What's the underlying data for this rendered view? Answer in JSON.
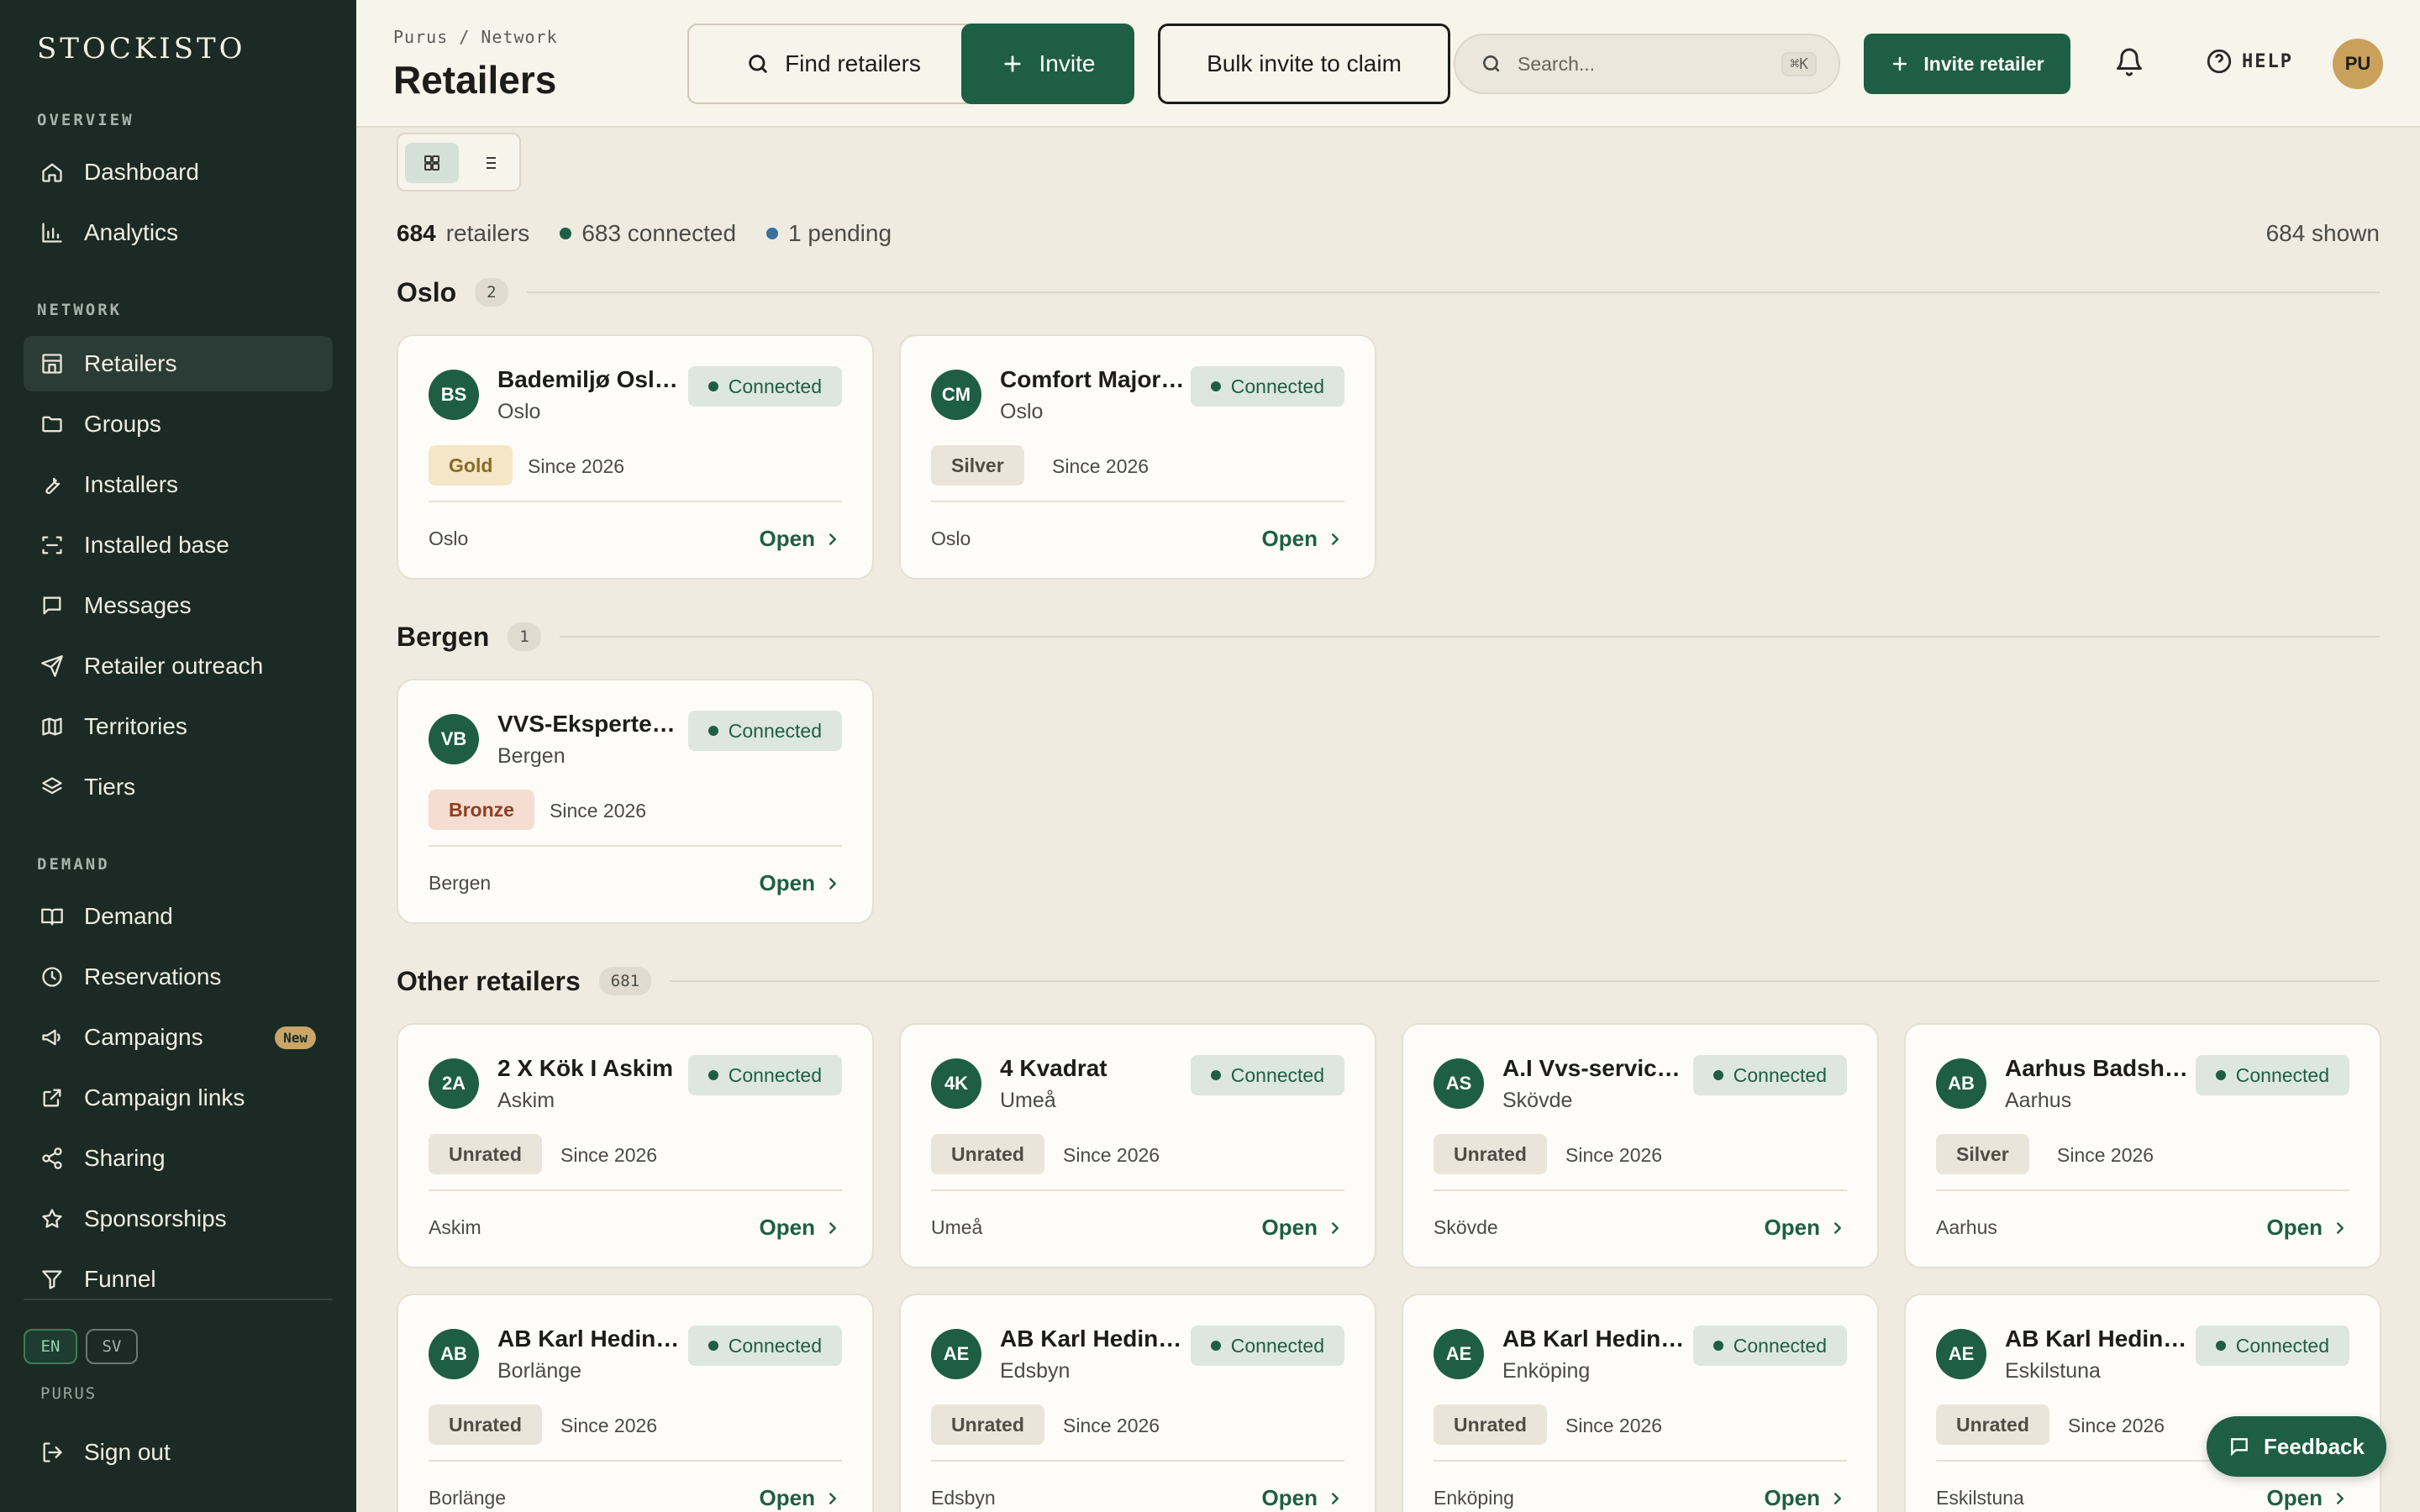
{
  "app": {
    "logo": "STOCKISTO"
  },
  "sidebar": {
    "sections": [
      {
        "label": "OVERVIEW"
      },
      {
        "label": "NETWORK"
      },
      {
        "label": "DEMAND"
      }
    ],
    "items": [
      {
        "label": "Dashboard",
        "icon": "home-icon"
      },
      {
        "label": "Analytics",
        "icon": "bar-chart-icon"
      },
      {
        "label": "Retailers",
        "icon": "store-icon",
        "active": true
      },
      {
        "label": "Groups",
        "icon": "folder-icon"
      },
      {
        "label": "Installers",
        "icon": "wrench-icon"
      },
      {
        "label": "Installed base",
        "icon": "scan-icon"
      },
      {
        "label": "Messages",
        "icon": "message-icon"
      },
      {
        "label": "Retailer outreach",
        "icon": "send-icon"
      },
      {
        "label": "Territories",
        "icon": "map-icon"
      },
      {
        "label": "Tiers",
        "icon": "layers-icon"
      },
      {
        "label": "Demand",
        "icon": "book-icon"
      },
      {
        "label": "Reservations",
        "icon": "clock-icon"
      },
      {
        "label": "Campaigns",
        "icon": "megaphone-icon",
        "badge": "New"
      },
      {
        "label": "Campaign links",
        "icon": "external-link-icon"
      },
      {
        "label": "Sharing",
        "icon": "share-icon"
      },
      {
        "label": "Sponsorships",
        "icon": "star-icon"
      },
      {
        "label": "Funnel",
        "icon": "funnel-icon"
      }
    ],
    "languages": {
      "en": "EN",
      "sv": "SV"
    },
    "org": "PURUS",
    "sign_out": "Sign out"
  },
  "header": {
    "breadcrumb": "Purus / Network",
    "title": "Retailers",
    "find_retailers": "Find retailers",
    "invite": "Invite",
    "bulk_invite": "Bulk invite to claim",
    "search_placeholder": "Search...",
    "search_shortcut": "⌘K",
    "invite_retailer": "Invite retailer",
    "help": "HELP",
    "user_initials": "PU"
  },
  "summary": {
    "total": "684",
    "total_label": "retailers",
    "connected": "683 connected",
    "pending": "1 pending",
    "shown": "684 shown",
    "colors": {
      "connected": "#1e5e44",
      "pending": "#3a6f9a"
    }
  },
  "groups": [
    {
      "name": "Oslo",
      "count": "2",
      "cards": [
        {
          "initials": "BS",
          "name": "Bademiljø Oslo Sentrum",
          "city": "Oslo",
          "status": "Connected",
          "tier": "Gold",
          "since": "Since 2026",
          "location": "Oslo",
          "open": "Open"
        },
        {
          "initials": "CM",
          "name": "Comfort Majorstuen",
          "city": "Oslo",
          "status": "Connected",
          "tier": "Silver",
          "since": "Since 2026",
          "location": "Oslo",
          "open": "Open"
        }
      ]
    },
    {
      "name": "Bergen",
      "count": "1",
      "cards": [
        {
          "initials": "VB",
          "name": "VVS-Eksperten Bergen",
          "city": "Bergen",
          "status": "Connected",
          "tier": "Bronze",
          "since": "Since 2026",
          "location": "Bergen",
          "open": "Open"
        }
      ]
    },
    {
      "name": "Other retailers",
      "count": "681",
      "cards": [
        {
          "initials": "2A",
          "name": "2 X Kök I Askim",
          "city": "Askim",
          "status": "Connected",
          "tier": "Unrated",
          "since": "Since 2026",
          "location": "Askim",
          "open": "Open"
        },
        {
          "initials": "4K",
          "name": "4 Kvadrat",
          "city": "Umeå",
          "status": "Connected",
          "tier": "Unrated",
          "since": "Since 2026",
          "location": "Umeå",
          "open": "Open"
        },
        {
          "initials": "AS",
          "name": "A.I Vvs-service AB",
          "city": "Skövde",
          "status": "Connected",
          "tier": "Unrated",
          "since": "Since 2026",
          "location": "Skövde",
          "open": "Open"
        },
        {
          "initials": "AB",
          "name": "Aarhus Badshop",
          "city": "Aarhus",
          "status": "Connected",
          "tier": "Silver",
          "since": "Since 2026",
          "location": "Aarhus",
          "open": "Open"
        },
        {
          "initials": "AB",
          "name": "AB Karl Hedin Bygghandel",
          "city": "Borlänge",
          "status": "Connected",
          "tier": "Unrated",
          "since": "Since 2026",
          "location": "Borlänge",
          "open": "Open"
        },
        {
          "initials": "AE",
          "name": "AB Karl Hedin Bygghandel",
          "city": "Edsbyn",
          "status": "Connected",
          "tier": "Unrated",
          "since": "Since 2026",
          "location": "Edsbyn",
          "open": "Open"
        },
        {
          "initials": "AE",
          "name": "AB Karl Hedin Bygghandel",
          "city": "Enköping",
          "status": "Connected",
          "tier": "Unrated",
          "since": "Since 2026",
          "location": "Enköping",
          "open": "Open"
        },
        {
          "initials": "AE",
          "name": "AB Karl Hedin Bygghandel",
          "city": "Eskilstuna",
          "status": "Connected",
          "tier": "Unrated",
          "since": "Since 2026",
          "location": "Eskilstuna",
          "open": "Open"
        }
      ]
    }
  ],
  "feedback": "Feedback"
}
